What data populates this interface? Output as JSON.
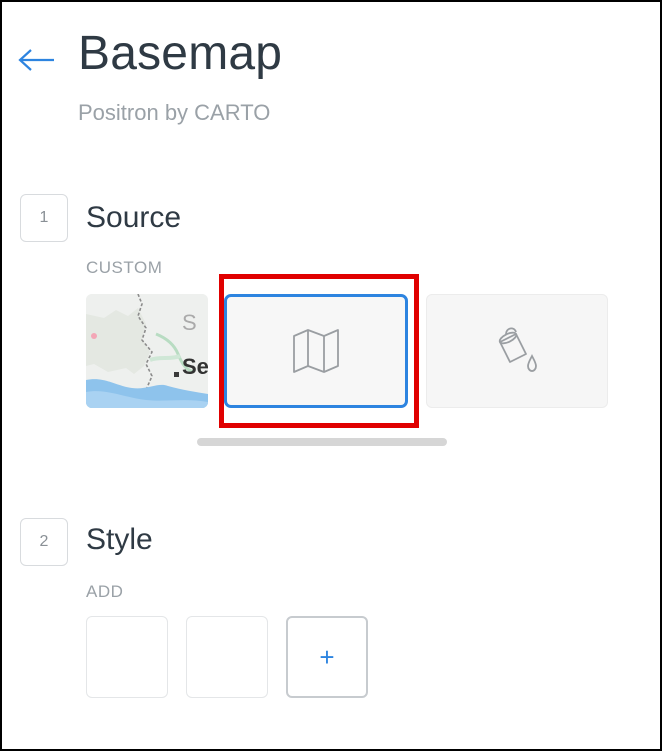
{
  "header": {
    "title": "Basemap",
    "subtitle": "Positron by CARTO",
    "back_icon": "arrow-left-icon"
  },
  "steps": [
    {
      "number": "1",
      "title": "Source",
      "caption": "CUSTOM"
    },
    {
      "number": "2",
      "title": "Style",
      "caption": "ADD"
    }
  ],
  "source_options": [
    {
      "name": "map-preview",
      "label": "Se",
      "label2": "S"
    },
    {
      "name": "custom-source",
      "icon": "map-icon",
      "selected": true
    },
    {
      "name": "paint",
      "icon": "paint-bucket-icon"
    }
  ],
  "style": {
    "add_label": "+"
  },
  "colors": {
    "accent": "#2d84e0",
    "highlight": "#e00000",
    "title": "#2f3a44",
    "muted": "#9aa1a7"
  }
}
